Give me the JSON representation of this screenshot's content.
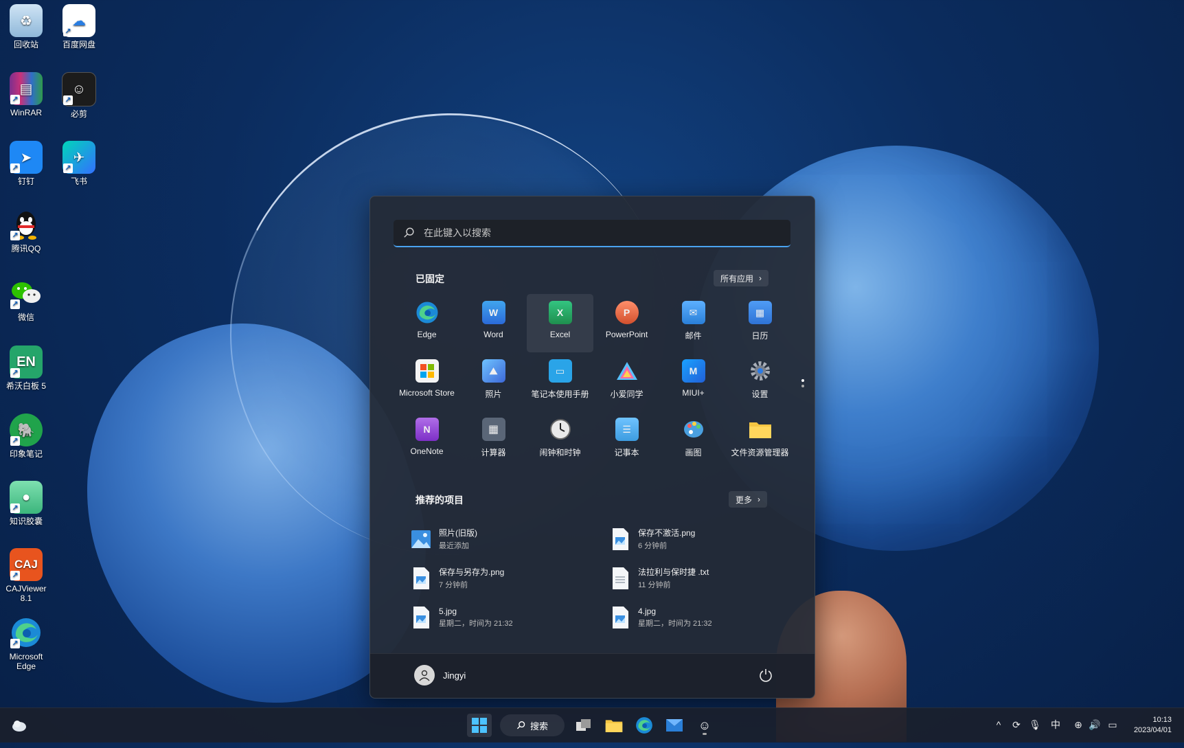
{
  "desktop": {
    "icons": [
      {
        "label": "回收站",
        "icon": "recycle-bin-icon",
        "color": "#9fc8e8"
      },
      {
        "label": "百度网盘",
        "icon": "baidu-netdisk-icon",
        "color": "#ffffff"
      },
      {
        "label": "WinRAR",
        "icon": "winrar-icon",
        "color": "#8e3f9c"
      },
      {
        "label": "必剪",
        "icon": "bijian-icon",
        "color": "#222222"
      },
      {
        "label": "钉钉",
        "icon": "dingtalk-icon",
        "color": "#1e88f5"
      },
      {
        "label": "飞书",
        "icon": "feishu-icon",
        "color": "#1fb8a4"
      },
      {
        "label": "腾讯QQ",
        "icon": "qq-icon",
        "color": "#111111"
      },
      {
        "label": "微信",
        "icon": "wechat-icon",
        "color": "#2dc100"
      },
      {
        "label": "希沃白板 5",
        "icon": "seewo-icon",
        "color": "#25a56a"
      },
      {
        "label": "印象笔记",
        "icon": "evernote-icon",
        "color": "#20a34b"
      },
      {
        "label": "知识胶囊",
        "icon": "knowledge-capsule-icon",
        "color": "#4cc38a"
      },
      {
        "label": "CAJViewer 8.1",
        "icon": "cajviewer-icon",
        "color": "#e8541e"
      },
      {
        "label": "Microsoft Edge",
        "icon": "edge-icon",
        "color": "#1b8ad6"
      }
    ]
  },
  "start_menu": {
    "search_placeholder": "在此键入以搜索",
    "pinned_title": "已固定",
    "all_apps_label": "所有应用",
    "pinned_apps": [
      {
        "label": "Edge",
        "icon": "edge-icon",
        "color": "#1b8ad6"
      },
      {
        "label": "Word",
        "icon": "word-icon",
        "color": "#2b6ad8"
      },
      {
        "label": "Excel",
        "icon": "excel-icon",
        "color": "#1f8f4e"
      },
      {
        "label": "PowerPoint",
        "icon": "powerpoint-icon",
        "color": "#d2502d"
      },
      {
        "label": "邮件",
        "icon": "mail-icon",
        "color": "#2a7fd8"
      },
      {
        "label": "日历",
        "icon": "calendar-icon",
        "color": "#2f73d6"
      },
      {
        "label": "Microsoft Store",
        "icon": "store-icon",
        "color": "#f4f4f4"
      },
      {
        "label": "照片",
        "icon": "photos-icon",
        "color": "#3d8ce0"
      },
      {
        "label": "笔记本使用手册",
        "icon": "laptop-manual-icon",
        "color": "#2aa4e8"
      },
      {
        "label": "小爱同学",
        "icon": "xiaoai-icon",
        "color": "#58c1ff"
      },
      {
        "label": "MIUI+",
        "icon": "miui-plus-icon",
        "color": "#2f8ff0"
      },
      {
        "label": "设置",
        "icon": "gear-icon",
        "color": "#8a8f99"
      },
      {
        "label": "OneNote",
        "icon": "onenote-icon",
        "color": "#8a3fcf"
      },
      {
        "label": "计算器",
        "icon": "calculator-icon",
        "color": "#5a6677"
      },
      {
        "label": "闹钟和时钟",
        "icon": "clock-icon",
        "color": "#d8d8d8"
      },
      {
        "label": "记事本",
        "icon": "notepad-icon",
        "color": "#3d9ce0"
      },
      {
        "label": "画图",
        "icon": "paint-icon",
        "color": "#e9a53a"
      },
      {
        "label": "文件资源管理器",
        "icon": "folder-icon",
        "color": "#f5c542"
      }
    ],
    "recommended_title": "推荐的项目",
    "more_label": "更多",
    "recommended": [
      {
        "name": "照片(旧版)",
        "sub": "最近添加",
        "icon": "photos-legacy-icon"
      },
      {
        "name": "保存不激活.png",
        "sub": "6 分钟前",
        "icon": "image-file-icon"
      },
      {
        "name": "保存与另存为.png",
        "sub": "7 分钟前",
        "icon": "image-file-icon"
      },
      {
        "name": "法拉利与保时捷 .txt",
        "sub": "11 分钟前",
        "icon": "text-file-icon"
      },
      {
        "name": "5.jpg",
        "sub": "星期二，时间为 21:32",
        "icon": "image-file-icon"
      },
      {
        "name": "4.jpg",
        "sub": "星期二，时间为 21:32",
        "icon": "image-file-icon"
      }
    ],
    "user_name": "Jingyi"
  },
  "taskbar": {
    "search_label": "搜索",
    "ime_label": "中",
    "time": "10:13",
    "date": "2023/04/01"
  }
}
